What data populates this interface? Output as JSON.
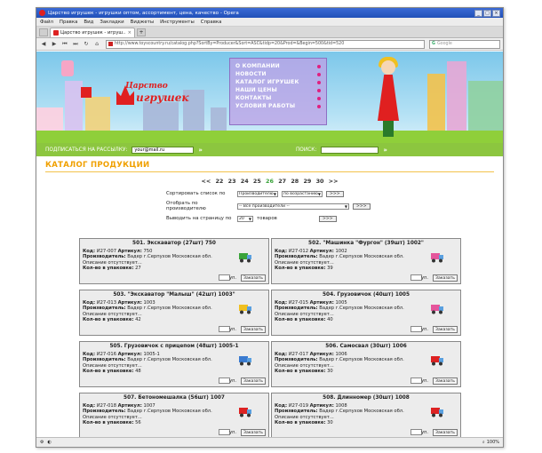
{
  "window": {
    "title": "Царство игрушек - игрушки оптом, ассортимент, цена, качество - Opera"
  },
  "menubar": [
    "Файл",
    "Правка",
    "Вид",
    "Закладки",
    "Виджеты",
    "Инструменты",
    "Справка"
  ],
  "tab": {
    "label": "Царство игрушек - игруш..."
  },
  "address": {
    "url": "http://www.toyscountry.ru/catalog.php?SortBy=Producer&Sort=ASC&tidp=20&Prod=&Begin=500&tid=520",
    "search_placeholder": "Google"
  },
  "site": {
    "logo_line1": "Царство",
    "logo_line2": "игрушек",
    "nav": [
      "О КОМПАНИИ",
      "НОВОСТИ",
      "КАТАЛОГ ИГРУШЕК",
      "НАШИ ЦЕНЫ",
      "КОНТАКТЫ",
      "УСЛОВИЯ РАБОТЫ"
    ],
    "subscribe_label": "ПОДПИСАТЬСЯ НА РАССЫЛКУ:",
    "subscribe_value": "your@mail.ru",
    "search_label": "ПОИСК:",
    "go_glyph": "»"
  },
  "catalog": {
    "title": "КАТАЛОГ ПРОДУКЦИИ",
    "pager": {
      "prev": "<<",
      "pages": [
        "22",
        "23",
        "24",
        "25",
        "26",
        "27",
        "28",
        "29",
        "30"
      ],
      "current": "26",
      "next": ">>"
    },
    "filters": {
      "sort_label": "Сортировать список по",
      "sort_field": "Производителю",
      "sort_dir": "по возрастанию",
      "filter_label": "Отобрать по производителю",
      "filter_value": "-- Все производители --",
      "per_page_label": "Выводить на страницу по",
      "per_page_value": "20",
      "per_page_suffix": "товаров",
      "go": ">>>"
    },
    "labels": {
      "code": "Код:",
      "article": "Артикул:",
      "producer": "Производитель:",
      "description": "Описание отсутствует...",
      "pack": "Кол-во в упаковке:",
      "unit": "уп.",
      "order": "Заказать"
    },
    "products": [
      {
        "title": "501. Экскаватор (27шт) 750",
        "code": "И27-007",
        "article": "750",
        "producer": "Вадер г.Серпухов Московская обл.",
        "pack": "27",
        "icon": "green"
      },
      {
        "title": "502. \"Машинка \"Фургон\" (39шт) 1002\"",
        "code": "И27-012",
        "article": "1002",
        "producer": "Вадер г.Серпухов Московская обл.",
        "pack": "39",
        "icon": "pink"
      },
      {
        "title": "503. \"Экскаватор \"Малыш\" (42шт) 1003\"",
        "code": "И27-013",
        "article": "1003",
        "producer": "Вадер г.Серпухов Московская обл.",
        "pack": "42",
        "icon": "yellow"
      },
      {
        "title": "504. Грузовичок (40шт) 1005",
        "code": "И27-015",
        "article": "1005",
        "producer": "Вадер г.Серпухов Московская обл.",
        "pack": "40",
        "icon": "pink"
      },
      {
        "title": "505. Грузовичок с прицепом (48шт) 1005-1",
        "code": "И27-016",
        "article": "1005-1",
        "producer": "Вадер г.Серпухов Московская обл.",
        "pack": "48",
        "icon": "blue"
      },
      {
        "title": "506. Самосвал (30шт) 1006",
        "code": "И27-017",
        "article": "1006",
        "producer": "Вадер г.Серпухов Московская обл.",
        "pack": "30",
        "icon": "red"
      },
      {
        "title": "507. Бетономешалка (56шт) 1007",
        "code": "И27-018",
        "article": "1007",
        "producer": "Вадер г.Серпухов Московская обл.",
        "pack": "56",
        "icon": "red"
      },
      {
        "title": "508. Длинномер (30шт) 1008",
        "code": "И27-019",
        "article": "1008",
        "producer": "Вадер г.Серпухов Московская обл.",
        "pack": "30",
        "icon": "red"
      }
    ]
  },
  "status": {
    "zoom": "100%"
  },
  "colors": {
    "accent_green": "#8cc63f",
    "title_orange": "#f0a000",
    "current_page": "#3aa33a",
    "brand_red": "#e02020"
  }
}
